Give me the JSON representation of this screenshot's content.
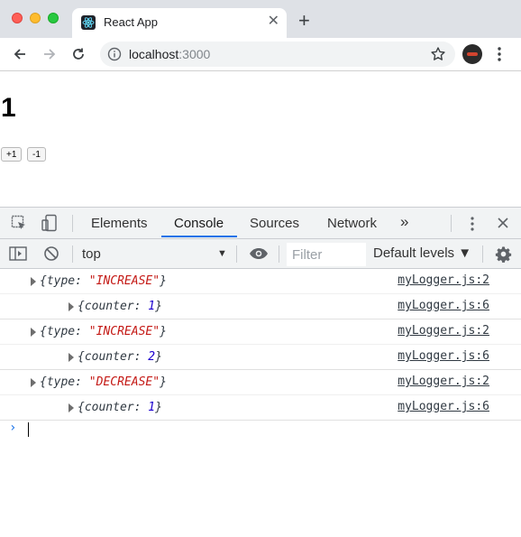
{
  "browser": {
    "tab_title": "React App",
    "new_tab_label": "+",
    "tab_close_label": "✕",
    "url_host": "localhost",
    "url_port": ":3000"
  },
  "page": {
    "counter_value": "1",
    "increment_label": "+1",
    "decrement_label": "-1"
  },
  "devtools": {
    "tabs": [
      "Elements",
      "Console",
      "Sources",
      "Network"
    ],
    "active_tab": "Console",
    "more_tabs_label": "»",
    "context": "top",
    "filter_placeholder": "Filter",
    "levels_label": "Default levels ▼",
    "prompt_symbol": "›",
    "logs": [
      {
        "indent": false,
        "key": "type",
        "value": "\"INCREASE\"",
        "value_kind": "string",
        "source": "myLogger.js:2"
      },
      {
        "indent": true,
        "key": "counter",
        "value": "1",
        "value_kind": "number",
        "source": "myLogger.js:6"
      },
      {
        "indent": false,
        "key": "type",
        "value": "\"INCREASE\"",
        "value_kind": "string",
        "source": "myLogger.js:2"
      },
      {
        "indent": true,
        "key": "counter",
        "value": "2",
        "value_kind": "number",
        "source": "myLogger.js:6"
      },
      {
        "indent": false,
        "key": "type",
        "value": "\"DECREASE\"",
        "value_kind": "string",
        "source": "myLogger.js:2"
      },
      {
        "indent": true,
        "key": "counter",
        "value": "1",
        "value_kind": "number",
        "source": "myLogger.js:6"
      }
    ]
  },
  "colors": {
    "accent": "#1a73e8",
    "string_value": "#c41a16",
    "number_value": "#1c00cf"
  }
}
